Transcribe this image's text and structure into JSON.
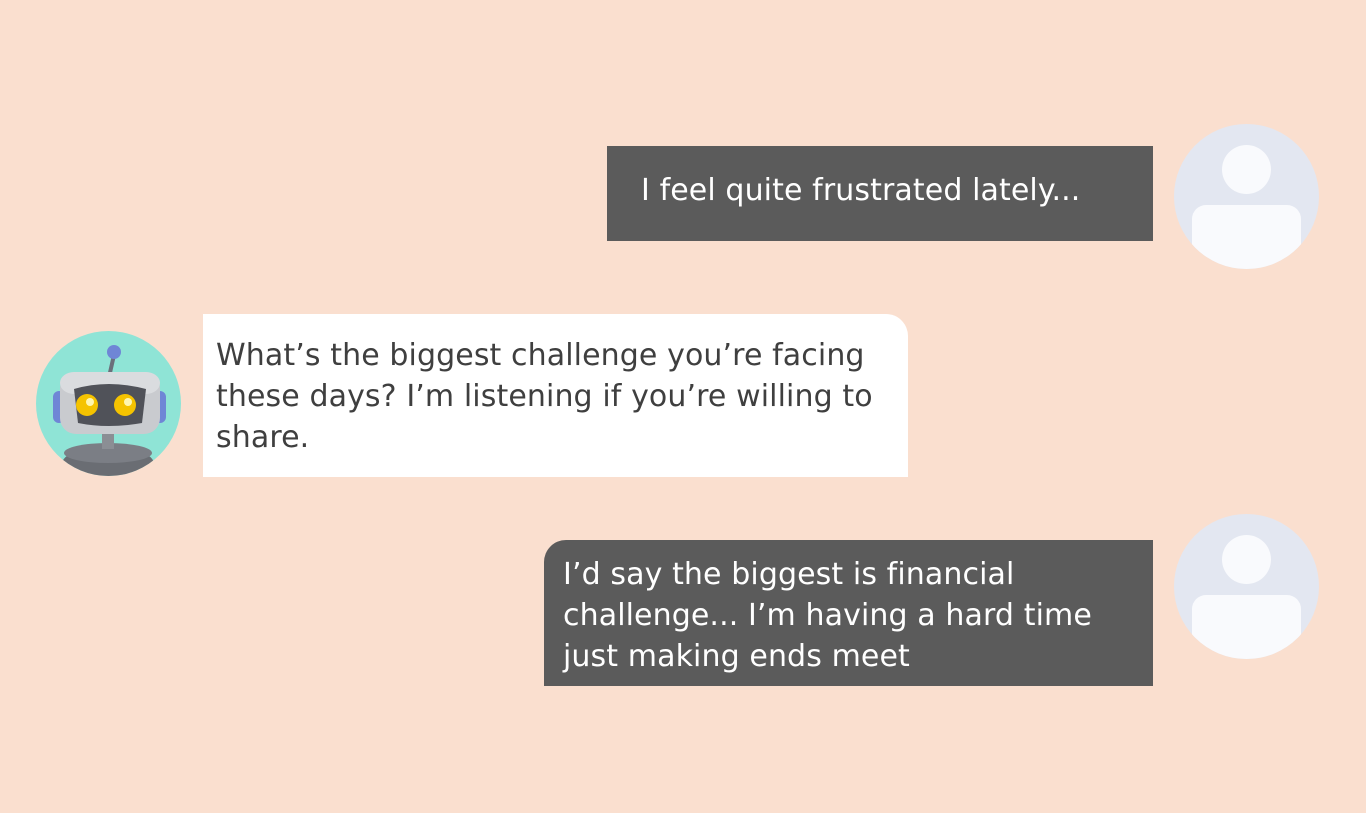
{
  "conversation": {
    "messages": [
      {
        "sender": "user",
        "text": "I feel quite frustrated lately..."
      },
      {
        "sender": "bot",
        "text": "What’s the biggest challenge you’re facing these days? I’m listening if you’re willing to share."
      },
      {
        "sender": "user",
        "text": "I’d say the biggest is financial challenge... I’m having a hard time just making ends meet"
      }
    ]
  },
  "avatars": {
    "user_icon": "user-placeholder-icon",
    "bot_icon": "robot-icon"
  },
  "colors": {
    "background": "#fadfcf",
    "user_bubble": "#5b5b5b",
    "user_text": "#ffffff",
    "bot_bubble": "#ffffff",
    "bot_text": "#3f3f3f",
    "bot_avatar_bg": "#8fe4d6",
    "user_avatar_bg": "#e3e7f1"
  }
}
